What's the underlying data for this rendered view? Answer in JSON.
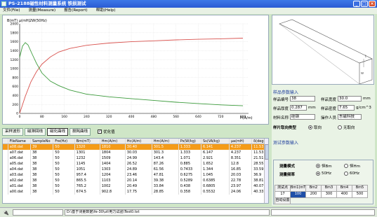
{
  "window": {
    "title": "PS-2188磁性材料测量系统   铁损测试",
    "min": "_",
    "max": "□",
    "close": "×"
  },
  "menu": [
    "文件(File)",
    "测量(Measure)",
    "报告(Report)",
    "帮助(Help)"
  ],
  "chart_data": {
    "type": "line",
    "title": "",
    "series_label": "2W(50Hz)",
    "y_unit": "B(mT) μ(mH)",
    "x_unit": "H(A/m)",
    "xlim": [
      0,
      820
    ],
    "ylim": [
      0,
      2000
    ],
    "xticks": [
      0,
      80,
      160,
      240,
      320,
      400,
      480,
      560,
      640,
      720,
      800
    ],
    "yticks": [
      0,
      200,
      400,
      600,
      800,
      1000,
      1200,
      1400,
      1600,
      1800,
      2000
    ],
    "grid": true,
    "series": [
      {
        "name": "B",
        "color": "#d9534f",
        "x": [
          0,
          20,
          40,
          60,
          80,
          110,
          140,
          180,
          240,
          320,
          400,
          480,
          560,
          640,
          720,
          800
        ],
        "y": [
          0,
          380,
          700,
          930,
          1100,
          1260,
          1370,
          1450,
          1520,
          1570,
          1600,
          1620,
          1640,
          1655,
          1665,
          1680
        ]
      },
      {
        "name": "μ",
        "color": "#3c9b3c",
        "x": [
          0,
          10,
          20,
          30,
          45,
          60,
          80,
          110,
          140,
          180,
          240,
          320,
          400,
          480,
          560,
          640,
          720,
          800
        ],
        "y": [
          1250,
          1500,
          1580,
          1530,
          1320,
          1120,
          900,
          720,
          620,
          520,
          430,
          370,
          330,
          290,
          250,
          220,
          190,
          170
        ]
      }
    ]
  },
  "controls": {
    "buttons": [
      "采样波形",
      "磁滞回线",
      "磁化曲线",
      "损耗曲线"
    ],
    "active_index": 2,
    "checkbox_label": "优化值",
    "checked": true
  },
  "grid": {
    "headers": [
      "",
      "FileName",
      "SampleNo",
      "Fre(Hz)",
      "Bm(mT)",
      "Hm(A/m)",
      "Hc(A/m)",
      "Hm(A/m)",
      "Ps(W/kg)",
      "Ss(VA/kg)",
      "μa(mH)",
      "δ(deg)"
    ],
    "rows": [
      [
        "",
        "a08.dat",
        "39",
        "50",
        "1320",
        "1810",
        "30.40",
        "301.5",
        "1.333",
        "6.141",
        "4.237",
        "11.53"
      ],
      [
        "",
        "a07.dat",
        "38",
        "50",
        "1301",
        "1804",
        "30.03",
        "301.3",
        "1.333",
        "6.147",
        "4.237",
        "11.53"
      ],
      [
        "",
        "a06.dat",
        "38",
        "50",
        "1232",
        "1509",
        "24.99",
        "143.4",
        "1.071",
        "2.921",
        "8.351",
        "21.51"
      ],
      [
        "",
        "a05.dat",
        "38",
        "50",
        "1145",
        "1404",
        "26.52",
        "87.26",
        "0.885",
        "1.652",
        "12.8",
        "28.55"
      ],
      [
        "",
        "a04.dat",
        "38",
        "50",
        "1051",
        "1303",
        "24.89",
        "61.56",
        "0.7433",
        "1.344",
        "16.85",
        "33.59"
      ],
      [
        "",
        "a03.dat",
        "38",
        "50",
        "957.4",
        "1204",
        "23.46",
        "47.81",
        "0.6275",
        "1.045",
        "20.03",
        "36.9"
      ],
      [
        "",
        "a02.dat",
        "38",
        "50",
        "865.5",
        "1103",
        "20.14",
        "39.38",
        "0.5289",
        "0.6385",
        "22.78",
        "38.81"
      ],
      [
        "",
        "a01.dat",
        "38",
        "50",
        "765.2",
        "1002",
        "20.49",
        "33.84",
        "0.438",
        "0.6805",
        "23.97",
        "40.07"
      ],
      [
        "",
        "a00.dat",
        "38",
        "50",
        "674.5",
        "902.8",
        "17.75",
        "28.85",
        "0.358",
        "0.5532",
        "24.06",
        "40.33"
      ]
    ],
    "selected_index": 0
  },
  "sample": {
    "section_title": "样品参数输入",
    "no_label": "样品编号",
    "no_value": "38",
    "width_label": "样品宽度",
    "width_value": "30.0",
    "width_unit": "mm",
    "thick_label": "样品厚度",
    "thick_value": "0.287",
    "thick_unit": "mm",
    "density_label": "样品密度",
    "density_value": "7.65",
    "density_unit": "g/cm^3",
    "material_label": "材料名称",
    "material_value": "硅钢",
    "operator_label": "操作人员",
    "operator_value": "东磁科技",
    "type_label": "样片取向类型",
    "type_opt1": "取向",
    "type_opt2": "无取向",
    "type_selected": 1
  },
  "measure": {
    "section_title": "测试参数输入",
    "mode_label": "测量模式",
    "mode_opt1": "恒Bm",
    "mode_opt2": "恒Hm",
    "mode_selected": 1,
    "freq_label": "测量频率",
    "freq_opt1": "50Hz",
    "freq_opt2": "60Hz",
    "freq_selected": 1,
    "table_headers": [
      "测试点",
      "Bm1(mT)",
      "Bm2",
      "Bm3",
      "Bm4",
      "Bm5"
    ],
    "table_row1": [
      "17",
      "100",
      "200",
      "300",
      "400",
      "500"
    ],
    "auto_label": "自动设置",
    "test_button": "测 试",
    "cancel_button": "取 消"
  },
  "status": {
    "icon": "🔌",
    "path": "D:\\基于测量数据\\fe-30\\ut\\电力试验\\Test0.txt"
  }
}
